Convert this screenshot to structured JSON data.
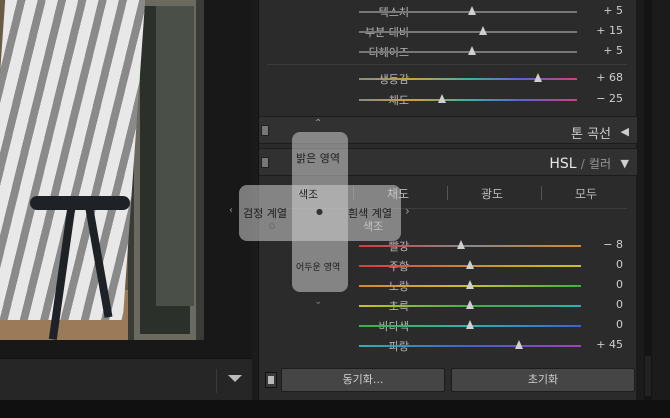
{
  "effects": {
    "rows": [
      {
        "label": "텍스처",
        "value": "+ 5",
        "thumb": 0.52,
        "gradient": "none"
      },
      {
        "label": "부분 대비",
        "value": "+ 15",
        "thumb": 0.57,
        "gradient": "none"
      },
      {
        "label": "디헤이즈",
        "value": "+ 5",
        "thumb": 0.52,
        "gradient": "none"
      }
    ]
  },
  "presence": {
    "rows": [
      {
        "label": "생동감",
        "value": "+ 68",
        "thumb": 0.82,
        "gradient": "sat"
      },
      {
        "label": "채도",
        "value": "− 25",
        "thumb": 0.38,
        "gradient": "sat"
      }
    ]
  },
  "tone_curve": {
    "title": "톤 곡선",
    "arrow": "◀"
  },
  "hsl": {
    "title_hsl": "HSL",
    "title_slash": "/",
    "title_color": "컬러",
    "arrow": "▼"
  },
  "tabs": [
    "색조",
    "채도",
    "광도",
    "모두"
  ],
  "hue": {
    "section_label": "색조",
    "rows": [
      {
        "label": "빨강",
        "value": "− 8",
        "thumb": 0.46
      },
      {
        "label": "주황",
        "value": "0",
        "thumb": 0.5
      },
      {
        "label": "노랑",
        "value": "0",
        "thumb": 0.5
      },
      {
        "label": "초록",
        "value": "0",
        "thumb": 0.5
      },
      {
        "label": "바다색",
        "value": "0",
        "thumb": 0.5
      },
      {
        "label": "파랑",
        "value": "+ 45",
        "thumb": 0.72
      }
    ]
  },
  "buttons": {
    "sync": "동기화...",
    "reset": "초기화"
  },
  "overlay": {
    "top": "밝은 영역",
    "left": "검정 계열",
    "right": "흰색 계열",
    "bottom": "어두운 영역",
    "center": "색조"
  },
  "colors": {
    "red": "#d04040",
    "orange": "#d08a30",
    "yellow": "#c8c030",
    "green": "#40b040",
    "aqua": "#30b0b0",
    "blue": "#4060d0"
  }
}
